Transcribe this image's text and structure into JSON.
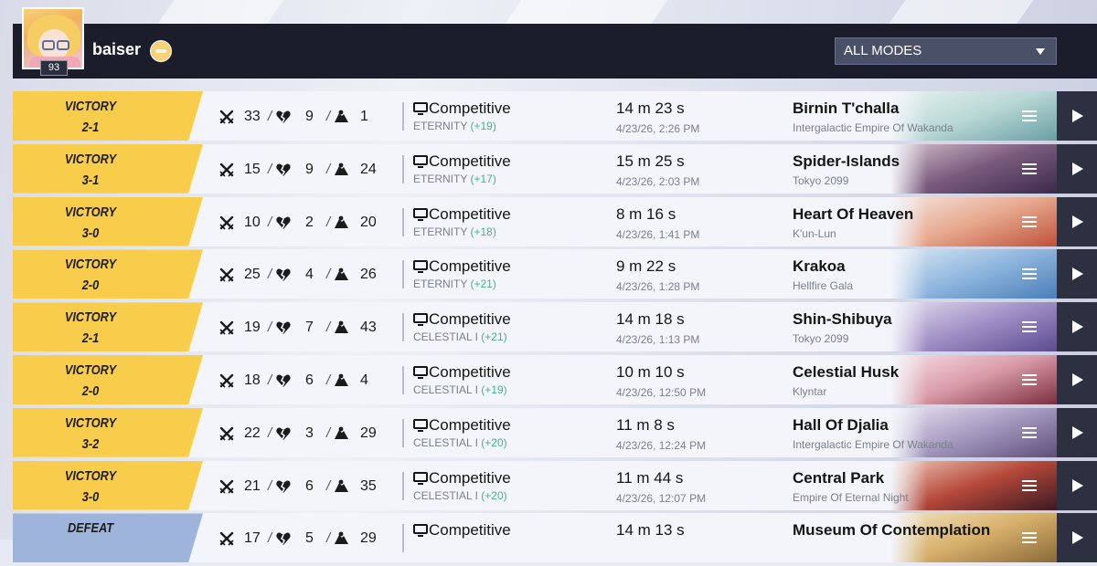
{
  "player": {
    "username": "baiser",
    "level": "93"
  },
  "filter": {
    "selected": "ALL MODES"
  },
  "colors": {
    "victory": "#f8cd4b",
    "defeat": "#9fb4da",
    "rank_gain": "#41b58a",
    "header": "#1b1e2a"
  },
  "icons": [
    "kills-crossed-swords-icon",
    "deaths-broken-heart-icon",
    "assists-icon",
    "monitor-icon",
    "menu-icon",
    "play-icon",
    "dropdown-caret-icon"
  ],
  "matches": [
    {
      "result": "VICTORY",
      "score": "2-1",
      "kills": "33",
      "deaths": "9",
      "assists": "1",
      "mode": "Competitive",
      "rank": "ETERNITY",
      "delta": "(+19)",
      "duration": "14 m 23 s",
      "date": "4/23/26, 2:26 PM",
      "map": "Birnin T'challa",
      "region": "Intergalactic Empire Of Wakanda",
      "art": [
        "#e9f2ef",
        "#b9d8d6",
        "#6a9fa3"
      ]
    },
    {
      "result": "VICTORY",
      "score": "3-1",
      "kills": "15",
      "deaths": "9",
      "assists": "24",
      "mode": "Competitive",
      "rank": "ETERNITY",
      "delta": "(+17)",
      "duration": "15 m 25 s",
      "date": "4/23/26, 2:03 PM",
      "map": "Spider-Islands",
      "region": "Tokyo 2099",
      "art": [
        "#d6c3cf",
        "#7a5b7d",
        "#3a2a4a"
      ]
    },
    {
      "result": "VICTORY",
      "score": "3-0",
      "kills": "10",
      "deaths": "2",
      "assists": "20",
      "mode": "Competitive",
      "rank": "ETERNITY",
      "delta": "(+18)",
      "duration": "8 m 16 s",
      "date": "4/23/26, 1:41 PM",
      "map": "Heart Of Heaven",
      "region": "K'un-Lun",
      "art": [
        "#f5e6e0",
        "#e7a98f",
        "#c0513a"
      ]
    },
    {
      "result": "VICTORY",
      "score": "2-0",
      "kills": "25",
      "deaths": "4",
      "assists": "26",
      "mode": "Competitive",
      "rank": "ETERNITY",
      "delta": "(+21)",
      "duration": "9 m 22 s",
      "date": "4/23/26, 1:28 PM",
      "map": "Krakoa",
      "region": "Hellfire Gala",
      "art": [
        "#dbe9f6",
        "#8fb6de",
        "#4a7fb8"
      ]
    },
    {
      "result": "VICTORY",
      "score": "2-1",
      "kills": "19",
      "deaths": "7",
      "assists": "43",
      "mode": "Competitive",
      "rank": "CELESTIAL I",
      "delta": "(+21)",
      "duration": "14 m 18 s",
      "date": "4/23/26, 1:13 PM",
      "map": "Shin-Shibuya",
      "region": "Tokyo 2099",
      "art": [
        "#e6dff0",
        "#a08fc6",
        "#5c4b8f"
      ]
    },
    {
      "result": "VICTORY",
      "score": "2-0",
      "kills": "18",
      "deaths": "6",
      "assists": "4",
      "mode": "Competitive",
      "rank": "CELESTIAL I",
      "delta": "(+19)",
      "duration": "10 m 10 s",
      "date": "4/23/26, 12:50 PM",
      "map": "Celestial Husk",
      "region": "Klyntar",
      "art": [
        "#f6e1e6",
        "#d99aa8",
        "#7a2f3e"
      ]
    },
    {
      "result": "VICTORY",
      "score": "3-2",
      "kills": "22",
      "deaths": "3",
      "assists": "29",
      "mode": "Competitive",
      "rank": "CELESTIAL I",
      "delta": "(+20)",
      "duration": "11 m 8 s",
      "date": "4/23/26, 12:24 PM",
      "map": "Hall Of Djalia",
      "region": "Intergalactic Empire Of Wakanda",
      "art": [
        "#e9e3f2",
        "#a79ac0",
        "#5d4f78"
      ]
    },
    {
      "result": "VICTORY",
      "score": "3-0",
      "kills": "21",
      "deaths": "6",
      "assists": "35",
      "mode": "Competitive",
      "rank": "CELESTIAL I",
      "delta": "(+20)",
      "duration": "11 m 44 s",
      "date": "4/23/26, 12:07 PM",
      "map": "Central Park",
      "region": "Empire Of Eternal Night",
      "art": [
        "#f0c9b8",
        "#b5483a",
        "#3b1a22"
      ]
    },
    {
      "result": "DEFEAT",
      "score": "",
      "kills": "17",
      "deaths": "5",
      "assists": "29",
      "mode": "Competitive",
      "rank": "",
      "delta": "",
      "duration": "14 m 13 s",
      "date": "",
      "map": "Museum Of Contemplation",
      "region": "",
      "art": [
        "#f3e4c3",
        "#d7b06b",
        "#8a6a3a"
      ]
    }
  ]
}
